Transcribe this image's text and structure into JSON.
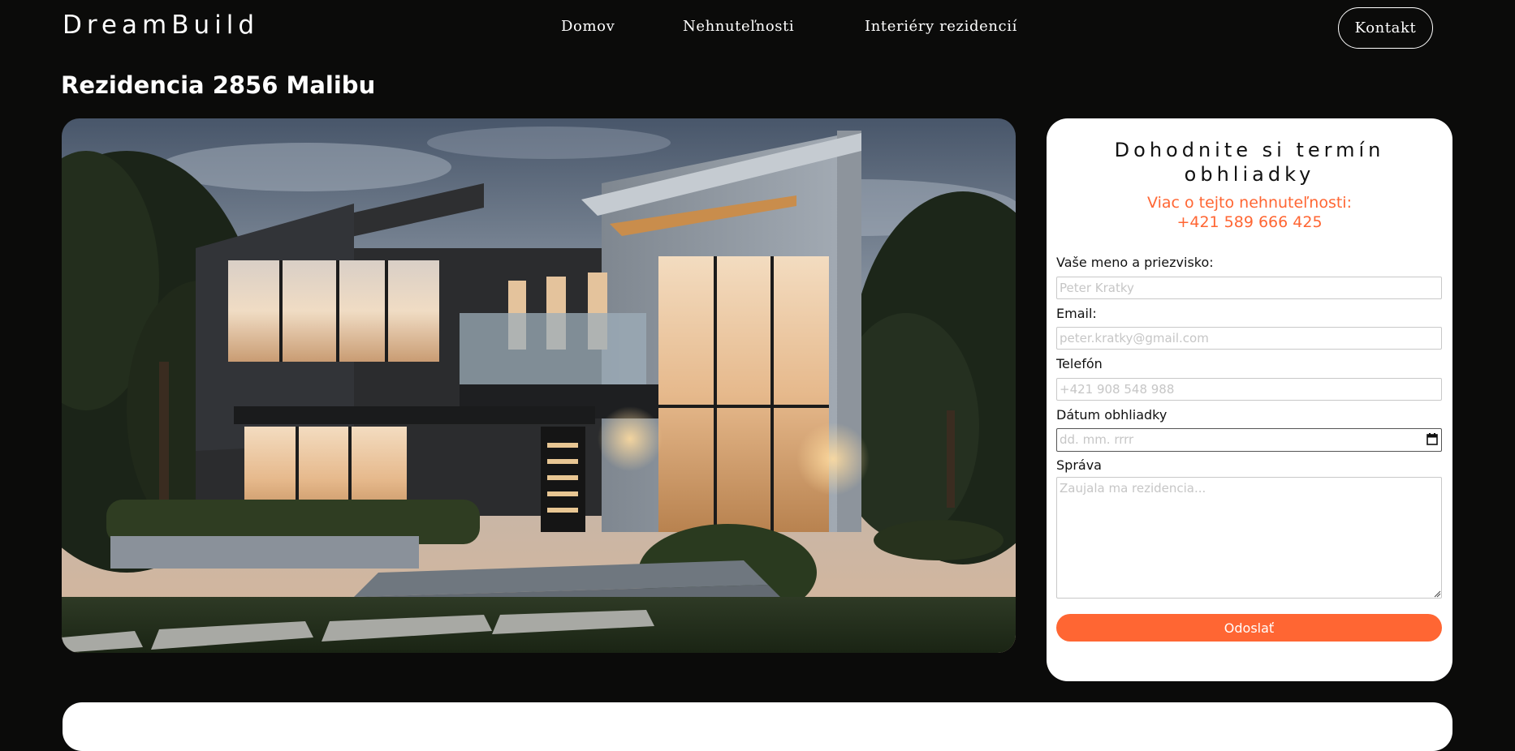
{
  "brand": "DreamBuild",
  "nav": {
    "items": [
      "Domov",
      "Nehnuteľnosti",
      "Interiéry rezidencií"
    ],
    "contact": "Kontakt"
  },
  "page": {
    "title": "Rezidencia 2856 Malibu"
  },
  "form": {
    "title": "Dohodnite si termín obhliadky",
    "info_line1": "Viac o tejto nehnuteľnosti:",
    "info_line2": "+421 589 666 425",
    "name_label": "Vaše meno a priezvisko:",
    "name_placeholder": "Peter Kratky",
    "email_label": "Email:",
    "email_placeholder": "peter.kratky@gmail.com",
    "phone_label": "Telefón",
    "phone_placeholder": "+421 908 548 988",
    "date_label": "Dátum obhliadky",
    "date_placeholder": "dd. mm. rrrr",
    "message_label": "Správa",
    "message_placeholder": "Zaujala ma rezidencia...",
    "submit": "Odoslať"
  },
  "colors": {
    "background": "#0b0b0a",
    "accent": "#ff6633",
    "card": "#ffffff"
  },
  "icons": {
    "calendar": "calendar-icon",
    "resize": "resize-handle-icon"
  }
}
